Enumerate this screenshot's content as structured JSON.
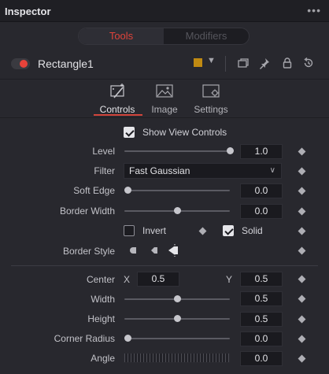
{
  "panel": {
    "title": "Inspector",
    "more_icon": "more-dots-icon",
    "more_label": "•••"
  },
  "mode_tabs": {
    "tools": "Tools",
    "modifiers": "Modifiers",
    "active": "tools",
    "accent": "#e0433a"
  },
  "node": {
    "name": "Rectangle1",
    "enabled": true,
    "color_swatch": "#c08a12",
    "icons": [
      "chevron-down-icon",
      "versions-icon",
      "pin-icon",
      "lock-icon",
      "reset-icon"
    ]
  },
  "tabs": [
    {
      "label": "Controls",
      "icon": "magic-wand-icon",
      "active": true
    },
    {
      "label": "Image",
      "icon": "image-icon",
      "active": false
    },
    {
      "label": "Settings",
      "icon": "settings-icon",
      "active": false
    }
  ],
  "controls": {
    "show_view_controls": {
      "label": "Show View Controls",
      "checked": true
    },
    "level": {
      "label": "Level",
      "value": "1.0",
      "fraction": 1.0
    },
    "filter": {
      "label": "Filter",
      "value": "Fast Gaussian"
    },
    "soft_edge": {
      "label": "Soft Edge",
      "value": "0.0",
      "fraction": 0.0
    },
    "border_width": {
      "label": "Border Width",
      "value": "0.0",
      "fraction": 0.5
    },
    "invert": {
      "label": "Invert",
      "checked": false
    },
    "solid": {
      "label": "Solid",
      "checked": true
    },
    "border_style": {
      "label": "Border Style",
      "options": [
        "border-round-icon",
        "border-bevel-icon",
        "border-miter-icon"
      ],
      "selected": 2
    },
    "center": {
      "label": "Center",
      "x_label": "X",
      "x": "0.5",
      "y_label": "Y",
      "y": "0.5"
    },
    "width": {
      "label": "Width",
      "value": "0.5",
      "fraction": 0.5
    },
    "height": {
      "label": "Height",
      "value": "0.5",
      "fraction": 0.5
    },
    "corner_radius": {
      "label": "Corner Radius",
      "value": "0.0",
      "fraction": 0.0
    },
    "angle": {
      "label": "Angle",
      "value": "0.0"
    }
  }
}
